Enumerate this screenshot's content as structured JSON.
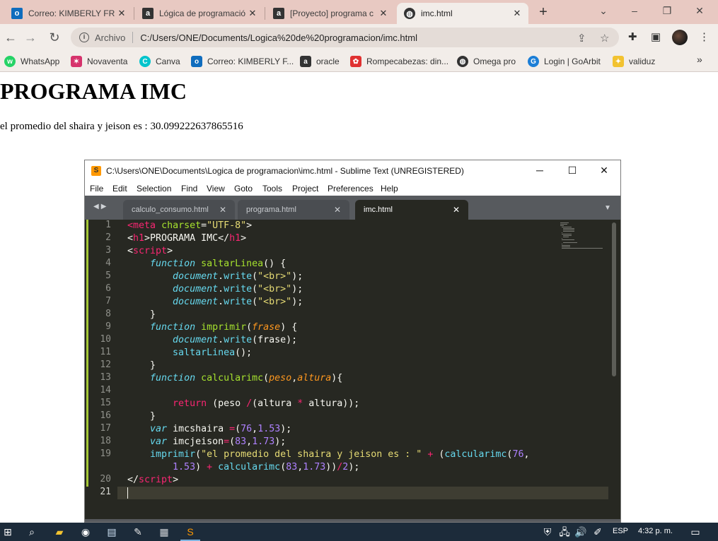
{
  "browser": {
    "tabs": [
      {
        "icon": "outlook-icon",
        "icon_color": "#0f6cbd",
        "label": "Correo: KIMBERLY FR -",
        "active": false
      },
      {
        "icon": "a-logo-icon",
        "icon_color": "#333333",
        "label": "Lógica de programació",
        "active": false
      },
      {
        "icon": "a-logo-icon",
        "icon_color": "#333333",
        "label": "[Proyecto] programa c",
        "active": false
      },
      {
        "icon": "globe-icon",
        "icon_color": "#333333",
        "label": "imc.html",
        "active": true
      }
    ],
    "new_tab_label": "+",
    "address": {
      "scheme_label": "Archivo",
      "url": "C:/Users/ONE/Documents/Logica%20de%20programacion/imc.html"
    },
    "bookmarks": [
      {
        "icon": "whatsapp-icon",
        "color": "#25d366",
        "label": "WhatsApp"
      },
      {
        "icon": "novaventa-icon",
        "color": "#d6336c",
        "label": "Novaventa"
      },
      {
        "icon": "canva-icon",
        "color": "#00c4cc",
        "label": "Canva"
      },
      {
        "icon": "outlook-icon",
        "color": "#0f6cbd",
        "label": "Correo: KIMBERLY F..."
      },
      {
        "icon": "a-logo-icon",
        "color": "#333333",
        "label": "oracle"
      },
      {
        "icon": "puzzle-game-icon",
        "color": "#e03131",
        "label": "Rompecabezas: din..."
      },
      {
        "icon": "globe-icon",
        "color": "#333333",
        "label": "Omega pro"
      },
      {
        "icon": "goarbit-icon",
        "color": "#1c7ed6",
        "label": "Login | GoArbit"
      },
      {
        "icon": "validuz-icon",
        "color": "#f2c230",
        "label": "validuz"
      }
    ],
    "bookmarks_more": "»"
  },
  "page": {
    "heading": "PROGRAMA IMC",
    "output": "el promedio del shaira y jeison es : 30.099222637865516"
  },
  "sublime": {
    "title": "C:\\Users\\ONE\\Documents\\Logica de programacion\\imc.html - Sublime Text (UNREGISTERED)",
    "menu": [
      "File",
      "Edit",
      "Selection",
      "Find",
      "View",
      "Goto",
      "Tools",
      "Project",
      "Preferences",
      "Help"
    ],
    "tabs": [
      {
        "label": "calculo_consumo.html",
        "active": false
      },
      {
        "label": "programa.html",
        "active": false
      },
      {
        "label": "imc.html",
        "active": true
      }
    ],
    "line_numbers": [
      "1",
      "2",
      "3",
      "4",
      "5",
      "6",
      "7",
      "8",
      "9",
      "10",
      "11",
      "12",
      "13",
      "14",
      "15",
      "16",
      "17",
      "18",
      "19",
      "",
      "20",
      "21"
    ],
    "current_line": "21"
  },
  "taskbar": {
    "language": "ESP",
    "time": "4:32 p. m."
  }
}
